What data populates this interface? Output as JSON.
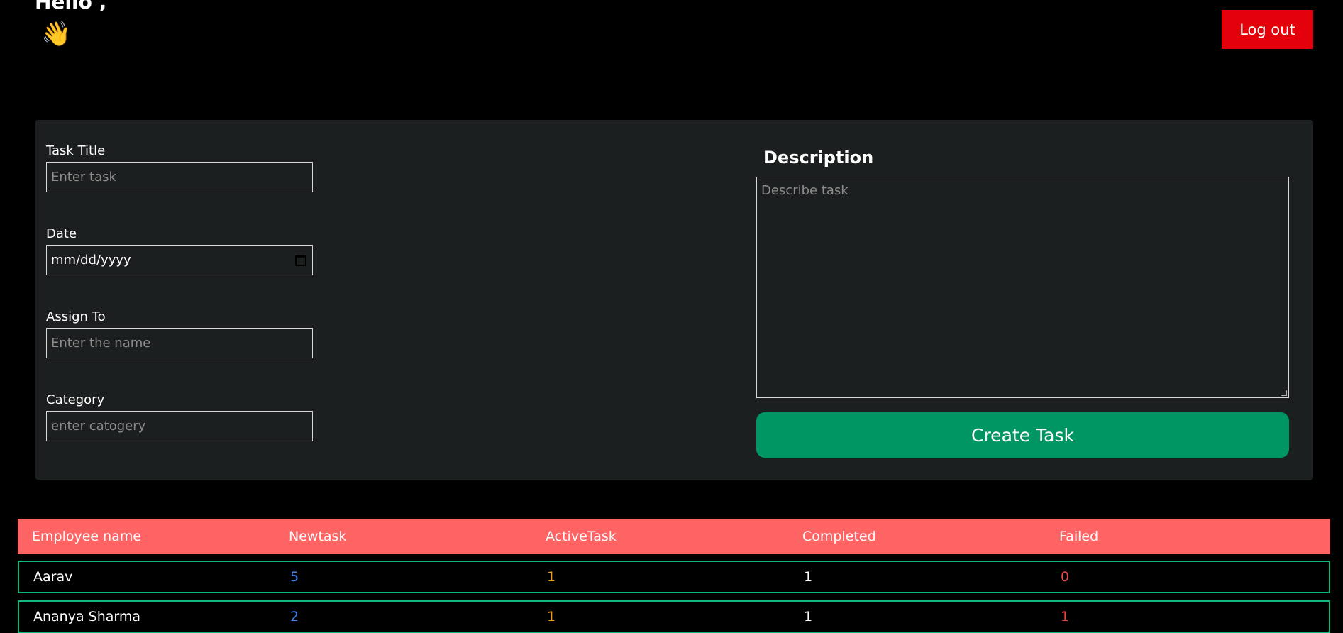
{
  "header": {
    "greeting": "Hello ,",
    "wave_emoji": "👋",
    "logout_label": "Log out"
  },
  "form": {
    "task_title_label": "Task Title",
    "task_title_placeholder": "Enter task",
    "date_label": "Date",
    "date_value": "mm/dd/yyyy",
    "assign_label": "Assign To",
    "assign_placeholder": "Enter the name",
    "category_label": "Category",
    "category_placeholder": "enter catogery",
    "description_label": "Description",
    "description_placeholder": "Describe task",
    "create_label": "Create Task"
  },
  "table": {
    "headers": [
      "Employee name",
      "Newtask",
      "ActiveTask",
      "Completed",
      "Failed"
    ],
    "rows": [
      {
        "name": "Aarav",
        "newtask": "5",
        "active": "1",
        "completed": "1",
        "failed": "0"
      },
      {
        "name": "Ananya Sharma",
        "newtask": "2",
        "active": "1",
        "completed": "1",
        "failed": "1"
      }
    ]
  },
  "colors": {
    "page_bg": "#000000",
    "panel_bg": "#1c1f20",
    "logout_bg": "#e3000b",
    "create_bg": "#009663",
    "table_header_bg": "#ff6465",
    "row_border": "#10b77f",
    "newtask_text": "#3b82f6",
    "active_text": "#f59e0b",
    "failed_text": "#ef4444"
  }
}
